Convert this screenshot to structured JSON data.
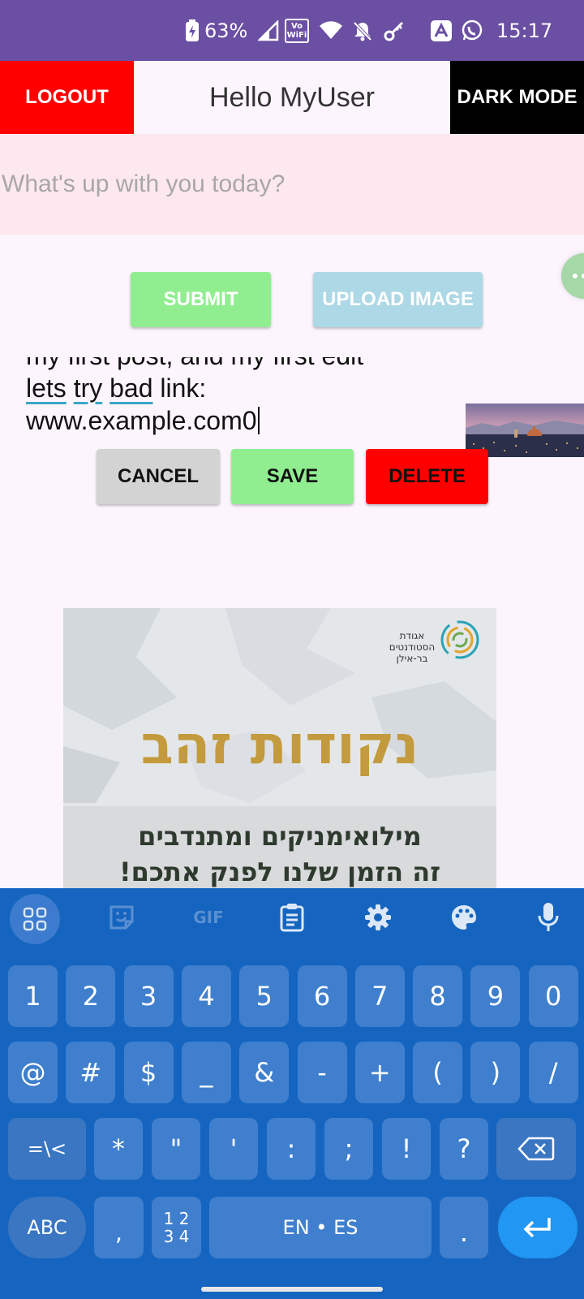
{
  "status_bar": {
    "battery": "63%",
    "time": "15:17",
    "wifi_label_top": "Vo",
    "wifi_label_bottom": "WiFi"
  },
  "header": {
    "logout_label": "LOGOUT",
    "title": "Hello MyUser",
    "dark_mode_label": "DARK MODE"
  },
  "composer": {
    "placeholder": "What's up with you today?"
  },
  "actions": {
    "submit_label": "SUBMIT",
    "upload_label": "UPLOAD IMAGE"
  },
  "post": {
    "line1": "my first post, and my first edit",
    "line2_w1": "lets",
    "line2_w2": "try",
    "line2_w3": "bad",
    "line2_rest": " link:",
    "line3": "www.example.com0",
    "cancel_label": "CANCEL",
    "save_label": "SAVE",
    "delete_label": "DELETE"
  },
  "ad": {
    "org_line1": "אגודת",
    "org_line2": "הסטודנטים",
    "org_line3": "בר-אילן",
    "headline": "נקודות זהב",
    "line1": "מילואימניקים ומתנדבים",
    "line2": "זה הזמן שלנו לפנק אתכם!"
  },
  "keyboard": {
    "toolbar": [
      "apps-grid-icon",
      "sticker-icon",
      "gif-icon",
      "clipboard-icon",
      "settings-icon",
      "palette-icon",
      "mic-icon"
    ],
    "gif_label": "GIF",
    "row1": [
      "1",
      "2",
      "3",
      "4",
      "5",
      "6",
      "7",
      "8",
      "9",
      "0"
    ],
    "row2": [
      "@",
      "#",
      "$",
      "_",
      "&",
      "-",
      "+",
      "(",
      ")",
      "/"
    ],
    "row3_left": "=\\<",
    "row3": [
      "*",
      "\"",
      "'",
      ":",
      ";",
      "!",
      "?"
    ],
    "abc_label": "ABC",
    "comma": ",",
    "numpad_top": "1 2",
    "numpad_bottom": "3 4",
    "space_label": "EN • ES",
    "period": "."
  },
  "colors": {
    "status_bar": "#6a4fa3",
    "logout": "#ff0000",
    "dark_mode": "#000000",
    "composer_bg": "#fde8ef",
    "submit": "#90ee90",
    "upload": "#add8e6",
    "keyboard_bg": "#1565c0",
    "enter_key": "#2196f3"
  }
}
